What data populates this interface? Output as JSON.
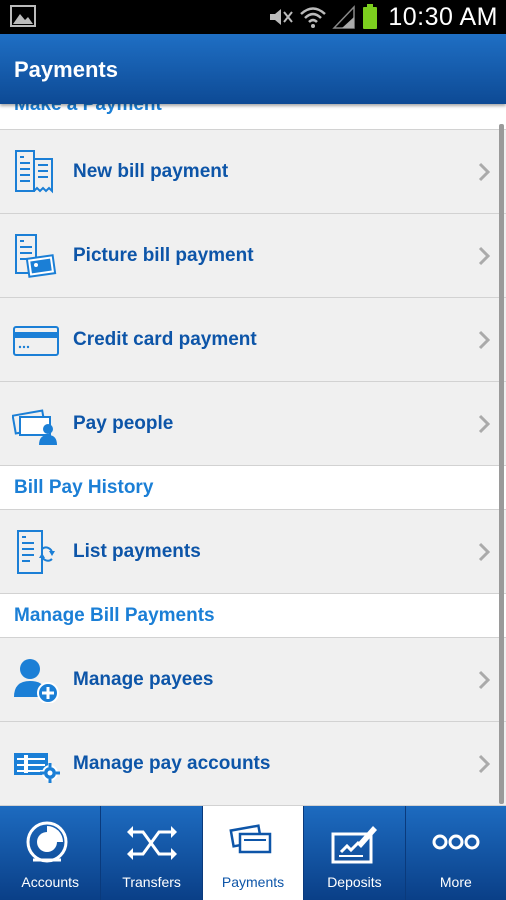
{
  "status_bar": {
    "time": "10:30 AM"
  },
  "header": {
    "title": "Payments"
  },
  "sections": [
    {
      "title": "Make a Payment",
      "items": [
        {
          "label": "New bill payment",
          "icon": "bill-icon"
        },
        {
          "label": "Picture bill payment",
          "icon": "picture-bill-icon"
        },
        {
          "label": "Credit card payment",
          "icon": "credit-card-icon"
        },
        {
          "label": "Pay people",
          "icon": "pay-people-icon"
        }
      ]
    },
    {
      "title": "Bill Pay History",
      "items": [
        {
          "label": "List payments",
          "icon": "list-payments-icon"
        }
      ]
    },
    {
      "title": "Manage Bill Payments",
      "items": [
        {
          "label": "Manage payees",
          "icon": "add-payee-icon"
        },
        {
          "label": "Manage pay accounts",
          "icon": "pay-accounts-icon"
        }
      ]
    }
  ],
  "bottom_nav": [
    {
      "label": "Accounts",
      "icon": "accounts-icon",
      "active": false
    },
    {
      "label": "Transfers",
      "icon": "transfers-icon",
      "active": false
    },
    {
      "label": "Payments",
      "icon": "payments-icon",
      "active": true
    },
    {
      "label": "Deposits",
      "icon": "deposits-icon",
      "active": false
    },
    {
      "label": "More",
      "icon": "more-icon",
      "active": false
    }
  ],
  "colors": {
    "accent": "#1b7fd6",
    "label_blue": "#0d55a8",
    "header_blue": "#1560b4"
  }
}
